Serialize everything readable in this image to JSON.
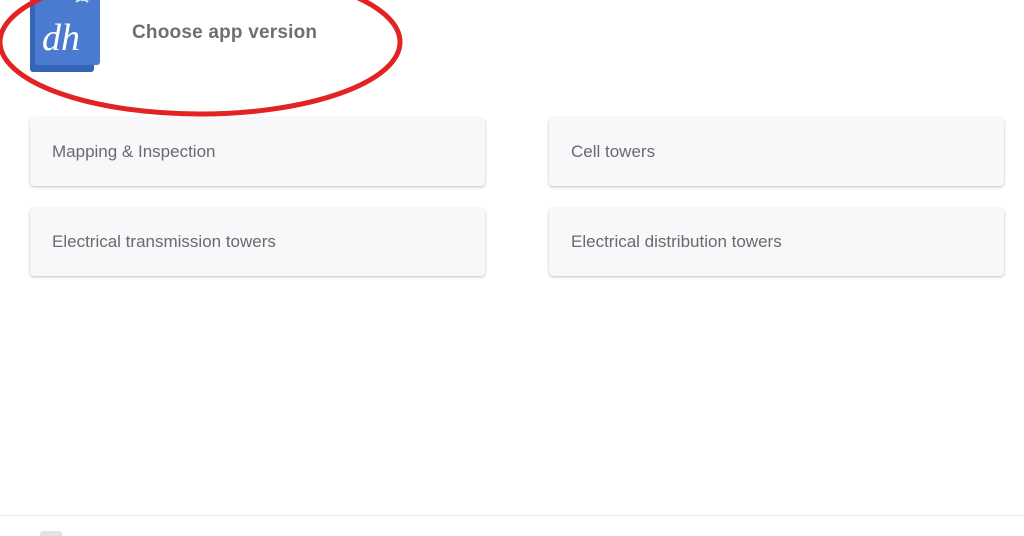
{
  "header": {
    "title": "Choose app version",
    "logo_text": "dh",
    "logo_color": "#3f6fc2"
  },
  "annotation": {
    "highlight_color": "#e32222"
  },
  "options": [
    {
      "label": "Mapping & Inspection"
    },
    {
      "label": "Cell towers"
    },
    {
      "label": "Electrical transmission towers"
    },
    {
      "label": "Electrical distribution towers"
    }
  ]
}
